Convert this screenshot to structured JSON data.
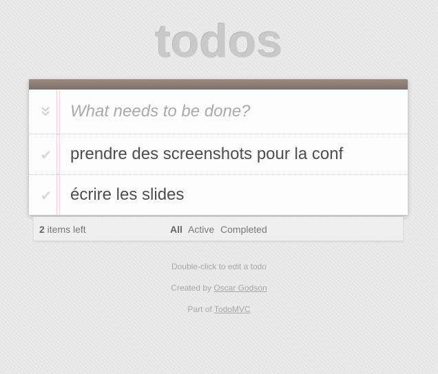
{
  "app": {
    "title": "todos"
  },
  "new_todo": {
    "placeholder": "What needs to be done?",
    "value": ""
  },
  "todos": [
    {
      "label": "prendre des screenshots pour la conf",
      "completed": false
    },
    {
      "label": "écrire les slides",
      "completed": false
    }
  ],
  "footer": {
    "count": "2",
    "count_suffix": " items left",
    "filters": [
      {
        "label": "All",
        "selected": true
      },
      {
        "label": "Active",
        "selected": false
      },
      {
        "label": "Completed",
        "selected": false
      }
    ]
  },
  "info": {
    "hint": "Double-click to edit a todo",
    "created_prefix": "Created by ",
    "created_link": "Oscar Godson",
    "part_prefix": "Part of ",
    "part_link": "TodoMVC"
  },
  "icons": {
    "toggle_all": "chevron-double-down-icon",
    "check": "checkmark-icon"
  },
  "colors": {
    "header_bar": "#7c6f69",
    "title": "#c9c9c9",
    "margin_line": "#f5d6d6"
  }
}
